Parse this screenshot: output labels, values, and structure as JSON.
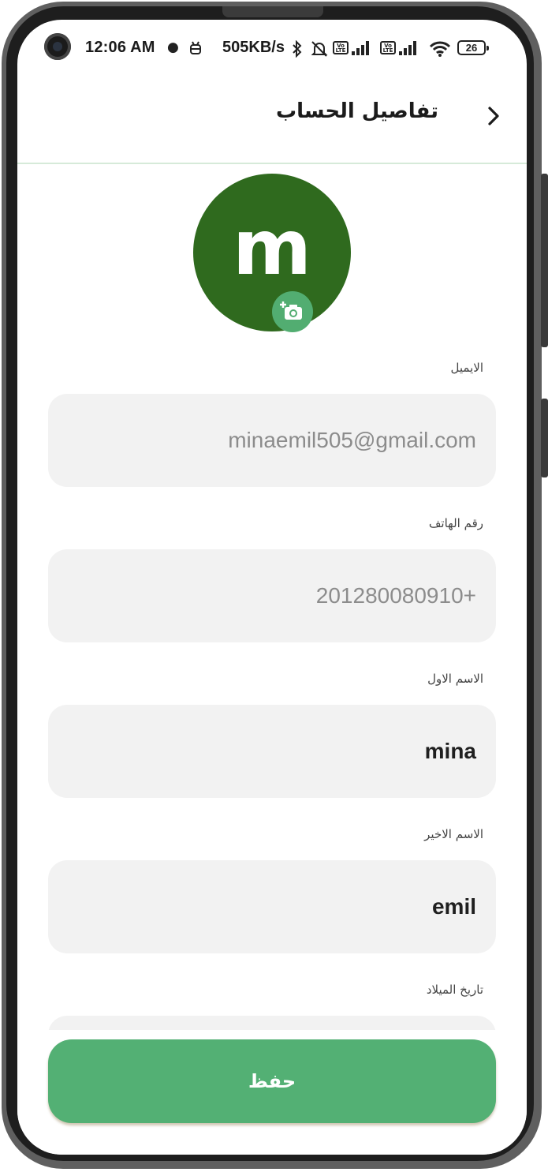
{
  "status_bar": {
    "time": "12:06 AM",
    "net_speed": "505KB/s",
    "battery": "26"
  },
  "app_bar": {
    "title": "تفاصيل الحساب",
    "back_icon": "chevron-right-icon"
  },
  "avatar": {
    "letter": "m",
    "color": "#2f6a1e",
    "camera_icon": "add-photo-icon",
    "camera_button_color": "#52ad71"
  },
  "form": {
    "email": {
      "label": "الايميل",
      "value": "minaemil505@gmail.com"
    },
    "phone": {
      "label": "رقم الهاتف",
      "value": "201280080910+"
    },
    "first_name": {
      "label": "الاسم الاول",
      "value": "mina"
    },
    "last_name": {
      "label": "الاسم الاخير",
      "value": "emil"
    },
    "birth_date": {
      "label": "تاريخ الميلاد",
      "value": ""
    }
  },
  "save_button": {
    "label": "حفظ",
    "color": "#53b074"
  }
}
